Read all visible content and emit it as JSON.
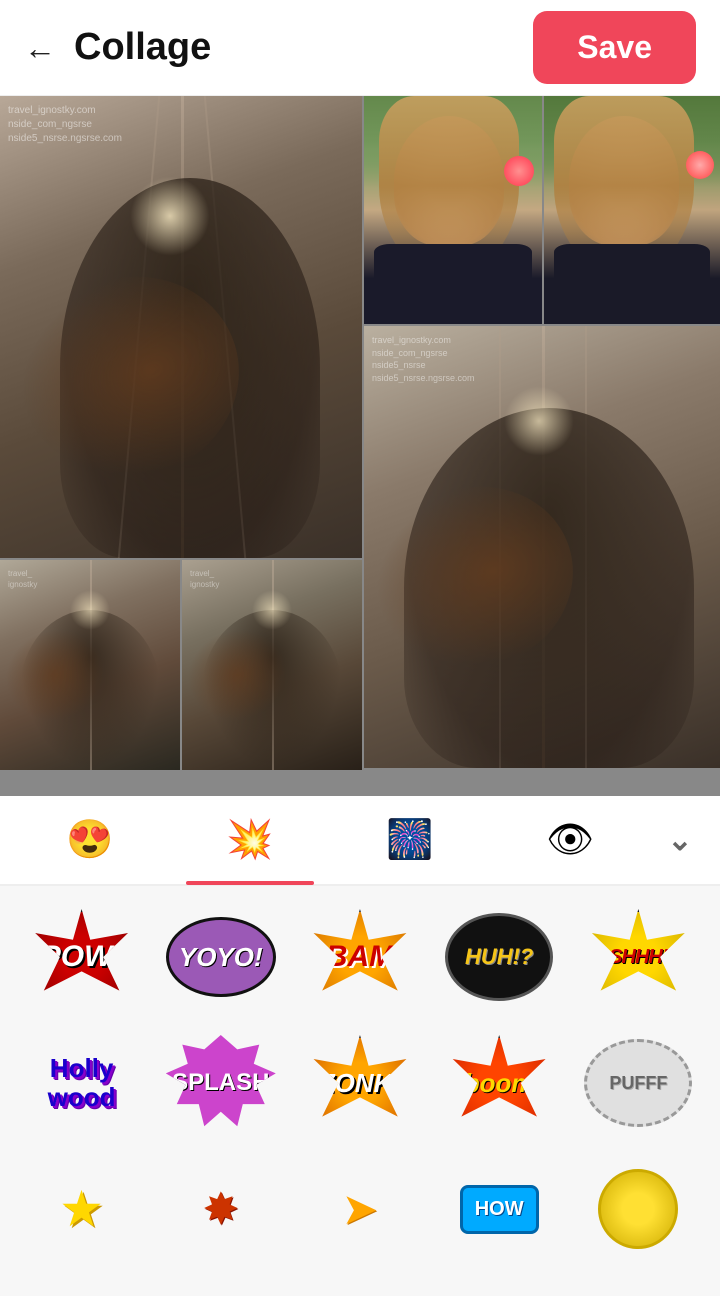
{
  "header": {
    "title": "Collage",
    "back_label": "←",
    "save_label": "Save"
  },
  "sticker_tabs": [
    {
      "id": "emoji",
      "icon": "😍",
      "active": false
    },
    {
      "id": "comic",
      "icon": "💥",
      "active": true
    },
    {
      "id": "sticker3",
      "icon": "🎆",
      "active": false
    },
    {
      "id": "sticker4",
      "icon": "👁",
      "active": false
    }
  ],
  "sticker_rows": [
    [
      {
        "id": "pow",
        "label": "POW!"
      },
      {
        "id": "yoyo",
        "label": "YOYO!"
      },
      {
        "id": "bam",
        "label": "BAM"
      },
      {
        "id": "huh",
        "label": "HUH!?"
      },
      {
        "id": "shhh",
        "label": "SHHH!"
      }
    ],
    [
      {
        "id": "hollywood",
        "label": "Holly\nwood"
      },
      {
        "id": "splash",
        "label": "SPLASH"
      },
      {
        "id": "zonk",
        "label": "ZONK!"
      },
      {
        "id": "boom",
        "label": "boom"
      },
      {
        "id": "pufff",
        "label": "PUFFF"
      }
    ],
    [
      {
        "id": "star1",
        "label": "★"
      },
      {
        "id": "burst1",
        "label": "✸"
      },
      {
        "id": "arrow1",
        "label": "➤"
      },
      {
        "id": "how",
        "label": "HOW"
      },
      {
        "id": "yellow",
        "label": ""
      }
    ]
  ],
  "more_icon": "⌄",
  "watermark_text": "travel_ignostky.com\nnside_com_ngsrse\nnside5_nsrse.ngsrse.com"
}
